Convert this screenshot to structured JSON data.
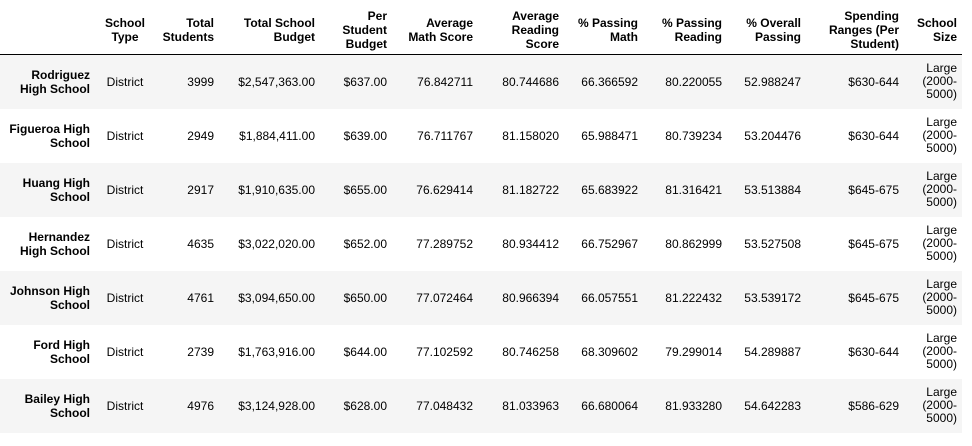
{
  "table": {
    "columns": [
      "",
      "School Type",
      "Total Students",
      "Total School Budget",
      "Per Student Budget",
      "Average Math Score",
      "Average Reading Score",
      "% Passing Math",
      "% Passing Reading",
      "% Overall Passing",
      "Spending Ranges (Per Student)",
      "School Size"
    ],
    "rows": [
      [
        "Rodriguez High School",
        "District",
        "3999",
        "$2,547,363.00",
        "$637.00",
        "76.842711",
        "80.744686",
        "66.366592",
        "80.220055",
        "52.988247",
        "$630-644",
        "Large (2000-5000)"
      ],
      [
        "Figueroa High School",
        "District",
        "2949",
        "$1,884,411.00",
        "$639.00",
        "76.711767",
        "81.158020",
        "65.988471",
        "80.739234",
        "53.204476",
        "$630-644",
        "Large (2000-5000)"
      ],
      [
        "Huang High School",
        "District",
        "2917",
        "$1,910,635.00",
        "$655.00",
        "76.629414",
        "81.182722",
        "65.683922",
        "81.316421",
        "53.513884",
        "$645-675",
        "Large (2000-5000)"
      ],
      [
        "Hernandez High School",
        "District",
        "4635",
        "$3,022,020.00",
        "$652.00",
        "77.289752",
        "80.934412",
        "66.752967",
        "80.862999",
        "53.527508",
        "$645-675",
        "Large (2000-5000)"
      ],
      [
        "Johnson High School",
        "District",
        "4761",
        "$3,094,650.00",
        "$650.00",
        "77.072464",
        "80.966394",
        "66.057551",
        "81.222432",
        "53.539172",
        "$645-675",
        "Large (2000-5000)"
      ],
      [
        "Ford High School",
        "District",
        "2739",
        "$1,763,916.00",
        "$644.00",
        "77.102592",
        "80.746258",
        "68.309602",
        "79.299014",
        "54.289887",
        "$630-644",
        "Large (2000-5000)"
      ],
      [
        "Bailey High School",
        "District",
        "4976",
        "$3,124,928.00",
        "$628.00",
        "77.048432",
        "81.033963",
        "66.680064",
        "81.933280",
        "54.642283",
        "$586-629",
        "Large (2000-5000)"
      ]
    ]
  }
}
